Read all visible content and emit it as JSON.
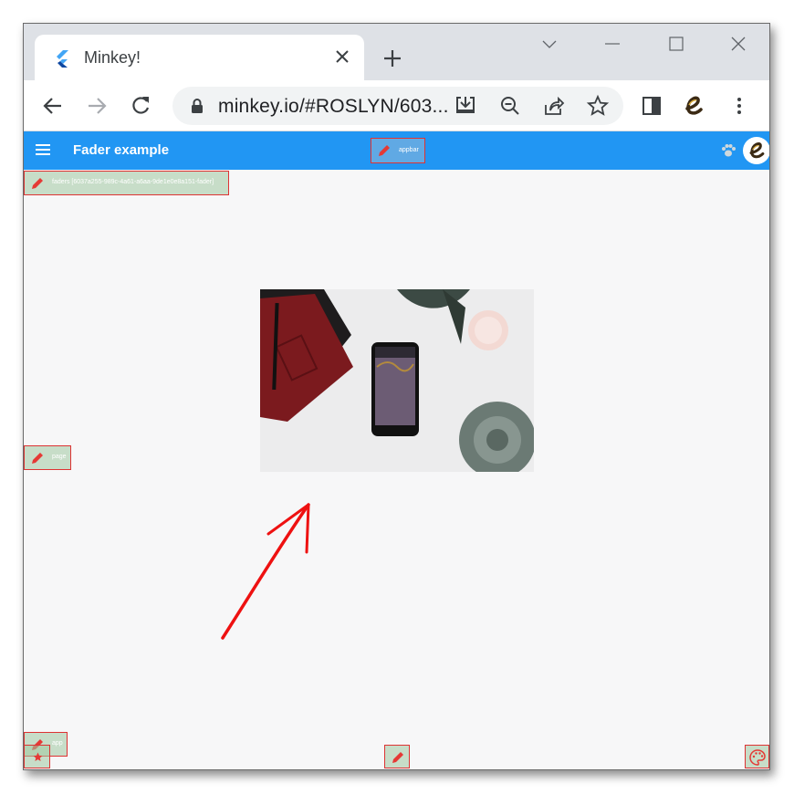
{
  "browser": {
    "tab_title": "Minkey!",
    "url": "minkey.io/#ROSLYN/603..."
  },
  "app": {
    "title": "Fader example",
    "tags": {
      "appbar": "appbar",
      "faders": "faders [6037a255-989c-4a61-a6aa-9de1e0e8a151-fader]",
      "page": "page",
      "app": "app"
    }
  },
  "colors": {
    "appbar": "#2196f3",
    "tag_border": "#dd3333",
    "arrow": "#ee1111"
  },
  "icons": [
    "flutter-icon",
    "close-icon",
    "plus-icon",
    "chevron-down-icon",
    "minimize-icon",
    "maximize-icon",
    "back-icon",
    "forward-icon",
    "reload-icon",
    "lock-icon",
    "install-icon",
    "zoom-out-icon",
    "share-icon",
    "star-icon",
    "sidepanel-icon",
    "extension-e-icon",
    "kebab-menu-icon",
    "menu-icon",
    "paw-icon",
    "pencil-icon",
    "palette-icon"
  ]
}
